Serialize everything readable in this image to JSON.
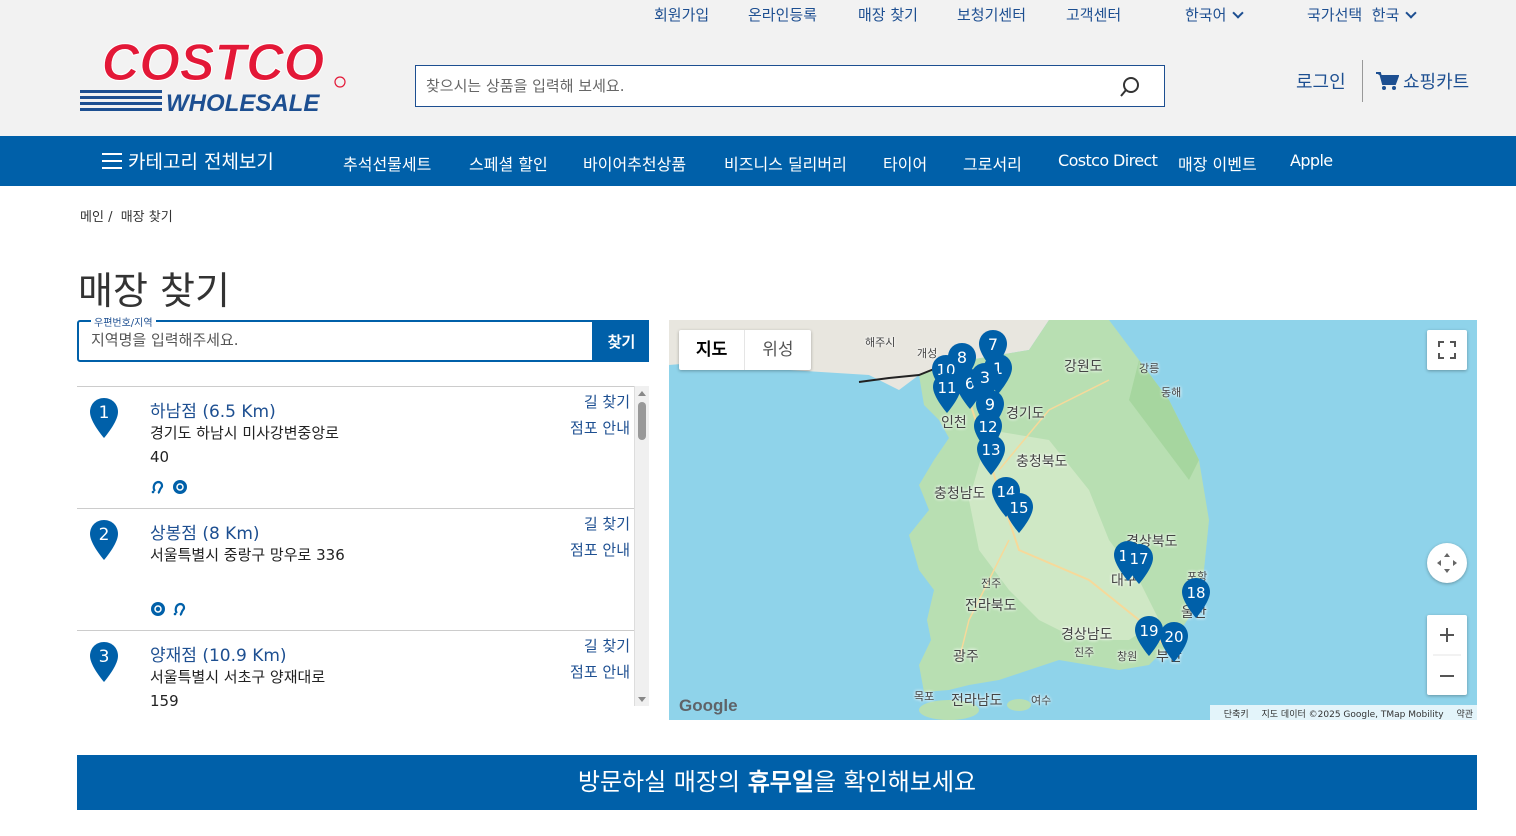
{
  "header": {
    "top_links": [
      {
        "label": "회원가입"
      },
      {
        "label": "온라인등록"
      },
      {
        "label": "매장 찾기"
      },
      {
        "label": "보청기센터"
      },
      {
        "label": "고객센터"
      }
    ],
    "language": "한국어",
    "country_label": "국가선택",
    "country_value": "한국",
    "logo_top": "COSTCO",
    "logo_bottom": "WHOLESALE",
    "search_placeholder": "찾으시는 상품을 입력해 보세요.",
    "login": "로그인",
    "cart": "쇼핑카트"
  },
  "nav": {
    "all_categories": "카테고리 전체보기",
    "items": [
      {
        "label": "추석선물세트"
      },
      {
        "label": "스페셜 할인"
      },
      {
        "label": "바이어추천상품"
      },
      {
        "label": "비즈니스 딜리버리"
      },
      {
        "label": "타이어"
      },
      {
        "label": "그로서리"
      },
      {
        "label": "Costco Direct"
      },
      {
        "label": "매장 이벤트"
      },
      {
        "label": "Apple"
      }
    ]
  },
  "breadcrumb": {
    "home": "메인",
    "separator": "/",
    "current": "매장 찾기"
  },
  "page_title": "매장 찾기",
  "store_search": {
    "label": "우편번호/지역",
    "placeholder": "지역명을 입력해주세요.",
    "button": "찾기"
  },
  "stores": [
    {
      "number": "1",
      "name": "하남점 (6.5 Km)",
      "address": "경기도 하남시 미사강변중앙로 40",
      "directions": "길 찾기",
      "info": "점포 안내"
    },
    {
      "number": "2",
      "name": "상봉점 (8 Km)",
      "address": "서울특별시 중랑구 망우로 336",
      "directions": "길 찾기",
      "info": "점포 안내"
    },
    {
      "number": "3",
      "name": "양재점 (10.9 Km)",
      "address": "서울특별시 서초구 양재대로 159",
      "directions": "길 찾기",
      "info": "점포 안내"
    }
  ],
  "map": {
    "type_map": "지도",
    "type_satellite": "위성",
    "labels": [
      {
        "text": "해주시",
        "small": true
      },
      {
        "text": "개성",
        "small": true
      },
      {
        "text": "강원도",
        "small": false
      },
      {
        "text": "강릉",
        "small": true
      },
      {
        "text": "동해",
        "small": true
      },
      {
        "text": "인천",
        "small": false
      },
      {
        "text": "경기도",
        "small": false
      },
      {
        "text": "충청북도",
        "small": false
      },
      {
        "text": "충청남도",
        "small": false
      },
      {
        "text": "경상북도",
        "small": false
      },
      {
        "text": "포항",
        "small": true
      },
      {
        "text": "전주",
        "small": true
      },
      {
        "text": "전라북도",
        "small": false
      },
      {
        "text": "대구",
        "small": false
      },
      {
        "text": "경상남도",
        "small": false
      },
      {
        "text": "광주",
        "small": false
      },
      {
        "text": "진주",
        "small": true
      },
      {
        "text": "창원",
        "small": true
      },
      {
        "text": "목포",
        "small": true
      },
      {
        "text": "전라남도",
        "small": false
      },
      {
        "text": "여수",
        "small": true
      },
      {
        "text": "울산",
        "small": false
      },
      {
        "text": "부산",
        "small": false
      }
    ],
    "markers": [
      "7",
      "8",
      "10",
      "1",
      "6",
      "3",
      "11",
      "9",
      "12",
      "13",
      "14",
      "15",
      "16",
      "17",
      "18",
      "19",
      "20"
    ],
    "google": "Google",
    "attribution": [
      "단축키",
      "지도 데이터 ©2025 Google, TMap Mobility",
      "약관"
    ]
  },
  "holiday_banner": {
    "before": "방문하실 매장의 ",
    "bold": "휴무일",
    "after": "을 확인해보세요"
  },
  "colors": {
    "brand_blue": "#0060a9",
    "link_blue": "#1d4f91",
    "costco_red": "#e31837"
  }
}
